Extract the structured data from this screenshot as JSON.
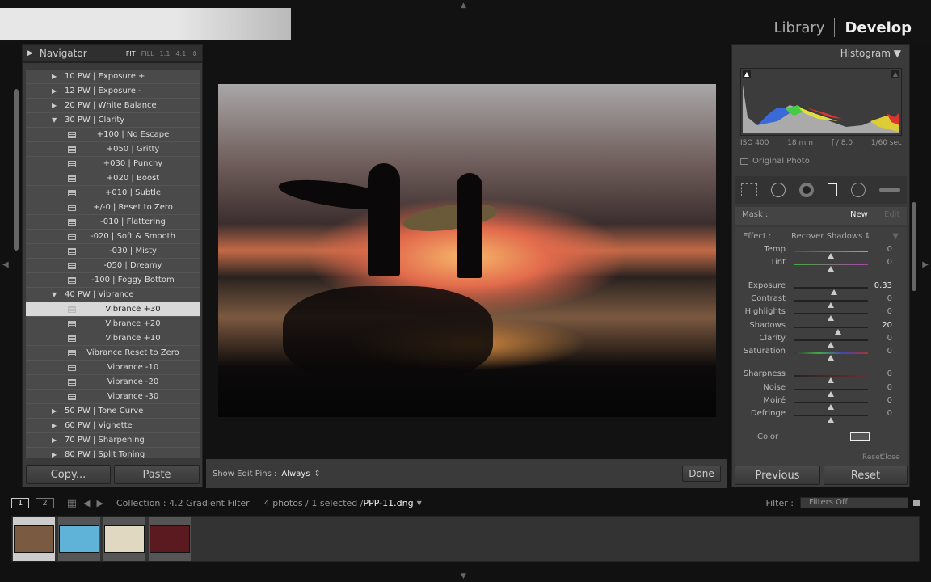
{
  "modules": {
    "library": "Library",
    "develop": "Develop"
  },
  "navigator": {
    "title": "Navigator",
    "zoom": [
      "FIT",
      "FILL",
      "1:1",
      "4:1"
    ]
  },
  "presets": [
    {
      "type": "folder",
      "open": false,
      "label": "10 PW | Exposure +"
    },
    {
      "type": "folder",
      "open": false,
      "label": "12 PW | Exposure -"
    },
    {
      "type": "folder",
      "open": false,
      "label": "20 PW | White Balance"
    },
    {
      "type": "folder",
      "open": true,
      "label": "30 PW | Clarity"
    },
    {
      "type": "preset",
      "label": "+100 | No Escape"
    },
    {
      "type": "preset",
      "label": "+050 | Gritty"
    },
    {
      "type": "preset",
      "label": "+030 | Punchy"
    },
    {
      "type": "preset",
      "label": "+020 | Boost"
    },
    {
      "type": "preset",
      "label": "+010 | Subtle"
    },
    {
      "type": "preset",
      "label": "+/-0 | Reset to Zero"
    },
    {
      "type": "preset",
      "label": "-010 | Flattering"
    },
    {
      "type": "preset",
      "label": "-020 | Soft & Smooth"
    },
    {
      "type": "preset",
      "label": "-030 | Misty"
    },
    {
      "type": "preset",
      "label": "-050 | Dreamy"
    },
    {
      "type": "preset",
      "label": "-100 | Foggy Bottom"
    },
    {
      "type": "folder",
      "open": true,
      "label": "40 PW | Vibrance"
    },
    {
      "type": "preset",
      "label": "Vibrance +30",
      "selected": true
    },
    {
      "type": "preset",
      "label": "Vibrance +20"
    },
    {
      "type": "preset",
      "label": "Vibrance +10"
    },
    {
      "type": "preset",
      "label": "Vibrance Reset to Zero"
    },
    {
      "type": "preset",
      "label": "Vibrance -10"
    },
    {
      "type": "preset",
      "label": "Vibrance -20"
    },
    {
      "type": "preset",
      "label": "Vibrance -30"
    },
    {
      "type": "folder",
      "open": false,
      "label": "50 PW | Tone Curve"
    },
    {
      "type": "folder",
      "open": false,
      "label": "60 PW | Vignette"
    },
    {
      "type": "folder",
      "open": false,
      "label": "70 PW | Sharpening"
    },
    {
      "type": "folder",
      "open": false,
      "label": "80 PW | Split Toning"
    }
  ],
  "left_buttons": {
    "copy": "Copy...",
    "paste": "Paste"
  },
  "toolbar": {
    "pins_label": "Show Edit Pins :",
    "pins_value": "Always",
    "done": "Done"
  },
  "histogram": {
    "title": "Histogram",
    "iso": "ISO 400",
    "focal": "18 mm",
    "aperture": "ƒ / 8.0",
    "shutter": "1/60 sec",
    "original_photo": "Original Photo"
  },
  "mask": {
    "label": "Mask :",
    "new": "New",
    "edit": "Edit"
  },
  "effect": {
    "label": "Effect :",
    "value": "Recover Shadows"
  },
  "sliders": [
    {
      "label": "Temp",
      "value": "0",
      "pos": 0.5,
      "group": 1
    },
    {
      "label": "Tint",
      "value": "0",
      "pos": 0.5,
      "group": 1
    },
    {
      "label": "Exposure",
      "value": "0.33",
      "pos": 0.54,
      "group": 2
    },
    {
      "label": "Contrast",
      "value": "0",
      "pos": 0.5,
      "group": 2
    },
    {
      "label": "Highlights",
      "value": "0",
      "pos": 0.5,
      "group": 2
    },
    {
      "label": "Shadows",
      "value": "20",
      "pos": 0.6,
      "group": 2
    },
    {
      "label": "Clarity",
      "value": "0",
      "pos": 0.5,
      "group": 2
    },
    {
      "label": "Saturation",
      "value": "0",
      "pos": 0.5,
      "group": 2
    },
    {
      "label": "Sharpness",
      "value": "0",
      "pos": 0.5,
      "group": 3
    },
    {
      "label": "Noise",
      "value": "0",
      "pos": 0.5,
      "group": 3
    },
    {
      "label": "Moiré",
      "value": "0",
      "pos": 0.5,
      "group": 3
    },
    {
      "label": "Defringe",
      "value": "0",
      "pos": 0.5,
      "group": 3
    }
  ],
  "color_label": "Color",
  "panel_footer": {
    "reset": "Reset",
    "close": "Close"
  },
  "right_buttons": {
    "previous": "Previous",
    "reset": "Reset"
  },
  "filmstrip": {
    "screen1": "1",
    "screen2": "2",
    "collection": "Collection : 4.2 Gradient Filter",
    "count": "4 photos / 1 selected /",
    "filename": "PPP-11.dng",
    "filter_label": "Filter :",
    "filter_value": "Filters Off"
  },
  "thumbs": [
    "#7a5a40",
    "#5fb3d8",
    "#e0d8c0",
    "#5a1a20"
  ]
}
